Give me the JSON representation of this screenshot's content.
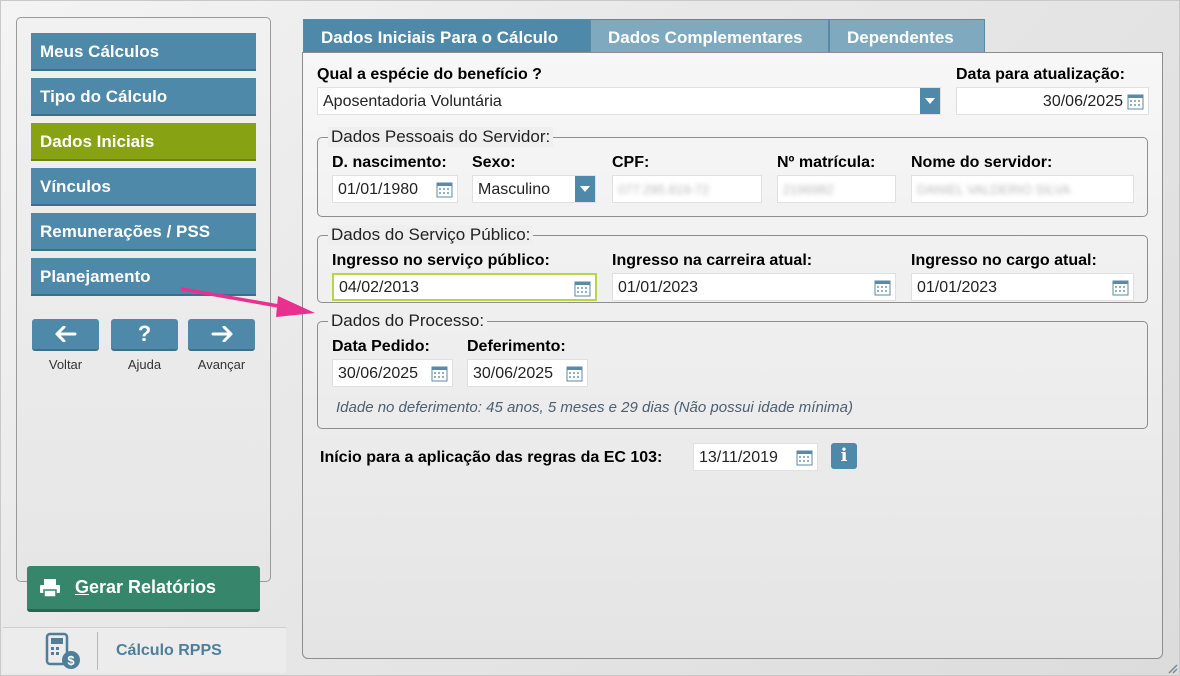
{
  "sidebar": {
    "items": [
      {
        "label": "Meus Cálculos"
      },
      {
        "label": "Tipo do Cálculo"
      },
      {
        "label": "Dados Iniciais"
      },
      {
        "label": "Vínculos"
      },
      {
        "label": "Remunerações / PSS"
      },
      {
        "label": "Planejamento"
      }
    ],
    "active_item": "Dados Iniciais",
    "buttons": {
      "back_label": "Voltar",
      "help_label": "Ajuda",
      "next_label": "Avançar",
      "help_glyph": "?"
    },
    "report_button": {
      "underlined_letter": "G",
      "rest": "erar Relatórios"
    },
    "logo_text": "Cálculo RPPS"
  },
  "tabs": [
    {
      "label": "Dados Iniciais Para o Cálculo",
      "active": true
    },
    {
      "label": "Dados Complementares",
      "active": false
    },
    {
      "label": "Dependentes",
      "active": false
    }
  ],
  "form": {
    "benefit_label": "Qual a espécie do benefício ?",
    "benefit_value": "Aposentadoria Voluntária",
    "update_date_label": "Data para atualização:",
    "update_date_value": "30/06/2025",
    "personal": {
      "legend": "Dados Pessoais do Servidor:",
      "birth_label": "D. nascimento:",
      "birth_value": "01/01/1980",
      "sex_label": "Sexo:",
      "sex_value": "Masculino",
      "cpf_label": "CPF:",
      "cpf_value": "077.295.819-72",
      "registration_label": "Nº matrícula:",
      "registration_value": "2196982",
      "name_label": "Nome do servidor:",
      "name_value": "DANIEL VALDERIO SILVA"
    },
    "public_service": {
      "legend": "Dados do Serviço Público:",
      "entry_service_label": "Ingresso no serviço público:",
      "entry_service_value": "04/02/2013",
      "entry_career_label": "Ingresso na carreira atual:",
      "entry_career_value": "01/01/2023",
      "entry_position_label": "Ingresso no cargo atual:",
      "entry_position_value": "01/01/2023"
    },
    "process": {
      "legend": "Dados do Processo:",
      "request_date_label": "Data Pedido:",
      "request_date_value": "30/06/2025",
      "approval_label": "Deferimento:",
      "approval_value": "30/06/2025",
      "age_note": "Idade no deferimento: 45 anos, 5 meses e 29 dias (Não possui idade mínima)"
    },
    "ec103_label": "Início para a aplicação das regras da EC 103:",
    "ec103_value": "13/11/2019",
    "info_glyph": "i"
  },
  "colors": {
    "accent": "#4e89a9",
    "active_nav": "#87a213",
    "report_button": "#35866a",
    "annotation_arrow": "#e8318f"
  },
  "icons": [
    "arrow-left-icon",
    "help-icon",
    "arrow-right-icon",
    "printer-icon",
    "calendar-icon",
    "select-arrow-icon",
    "info-icon",
    "calculator-logo-icon",
    "annotation-arrow-icon",
    "resize-grip-icon"
  ]
}
